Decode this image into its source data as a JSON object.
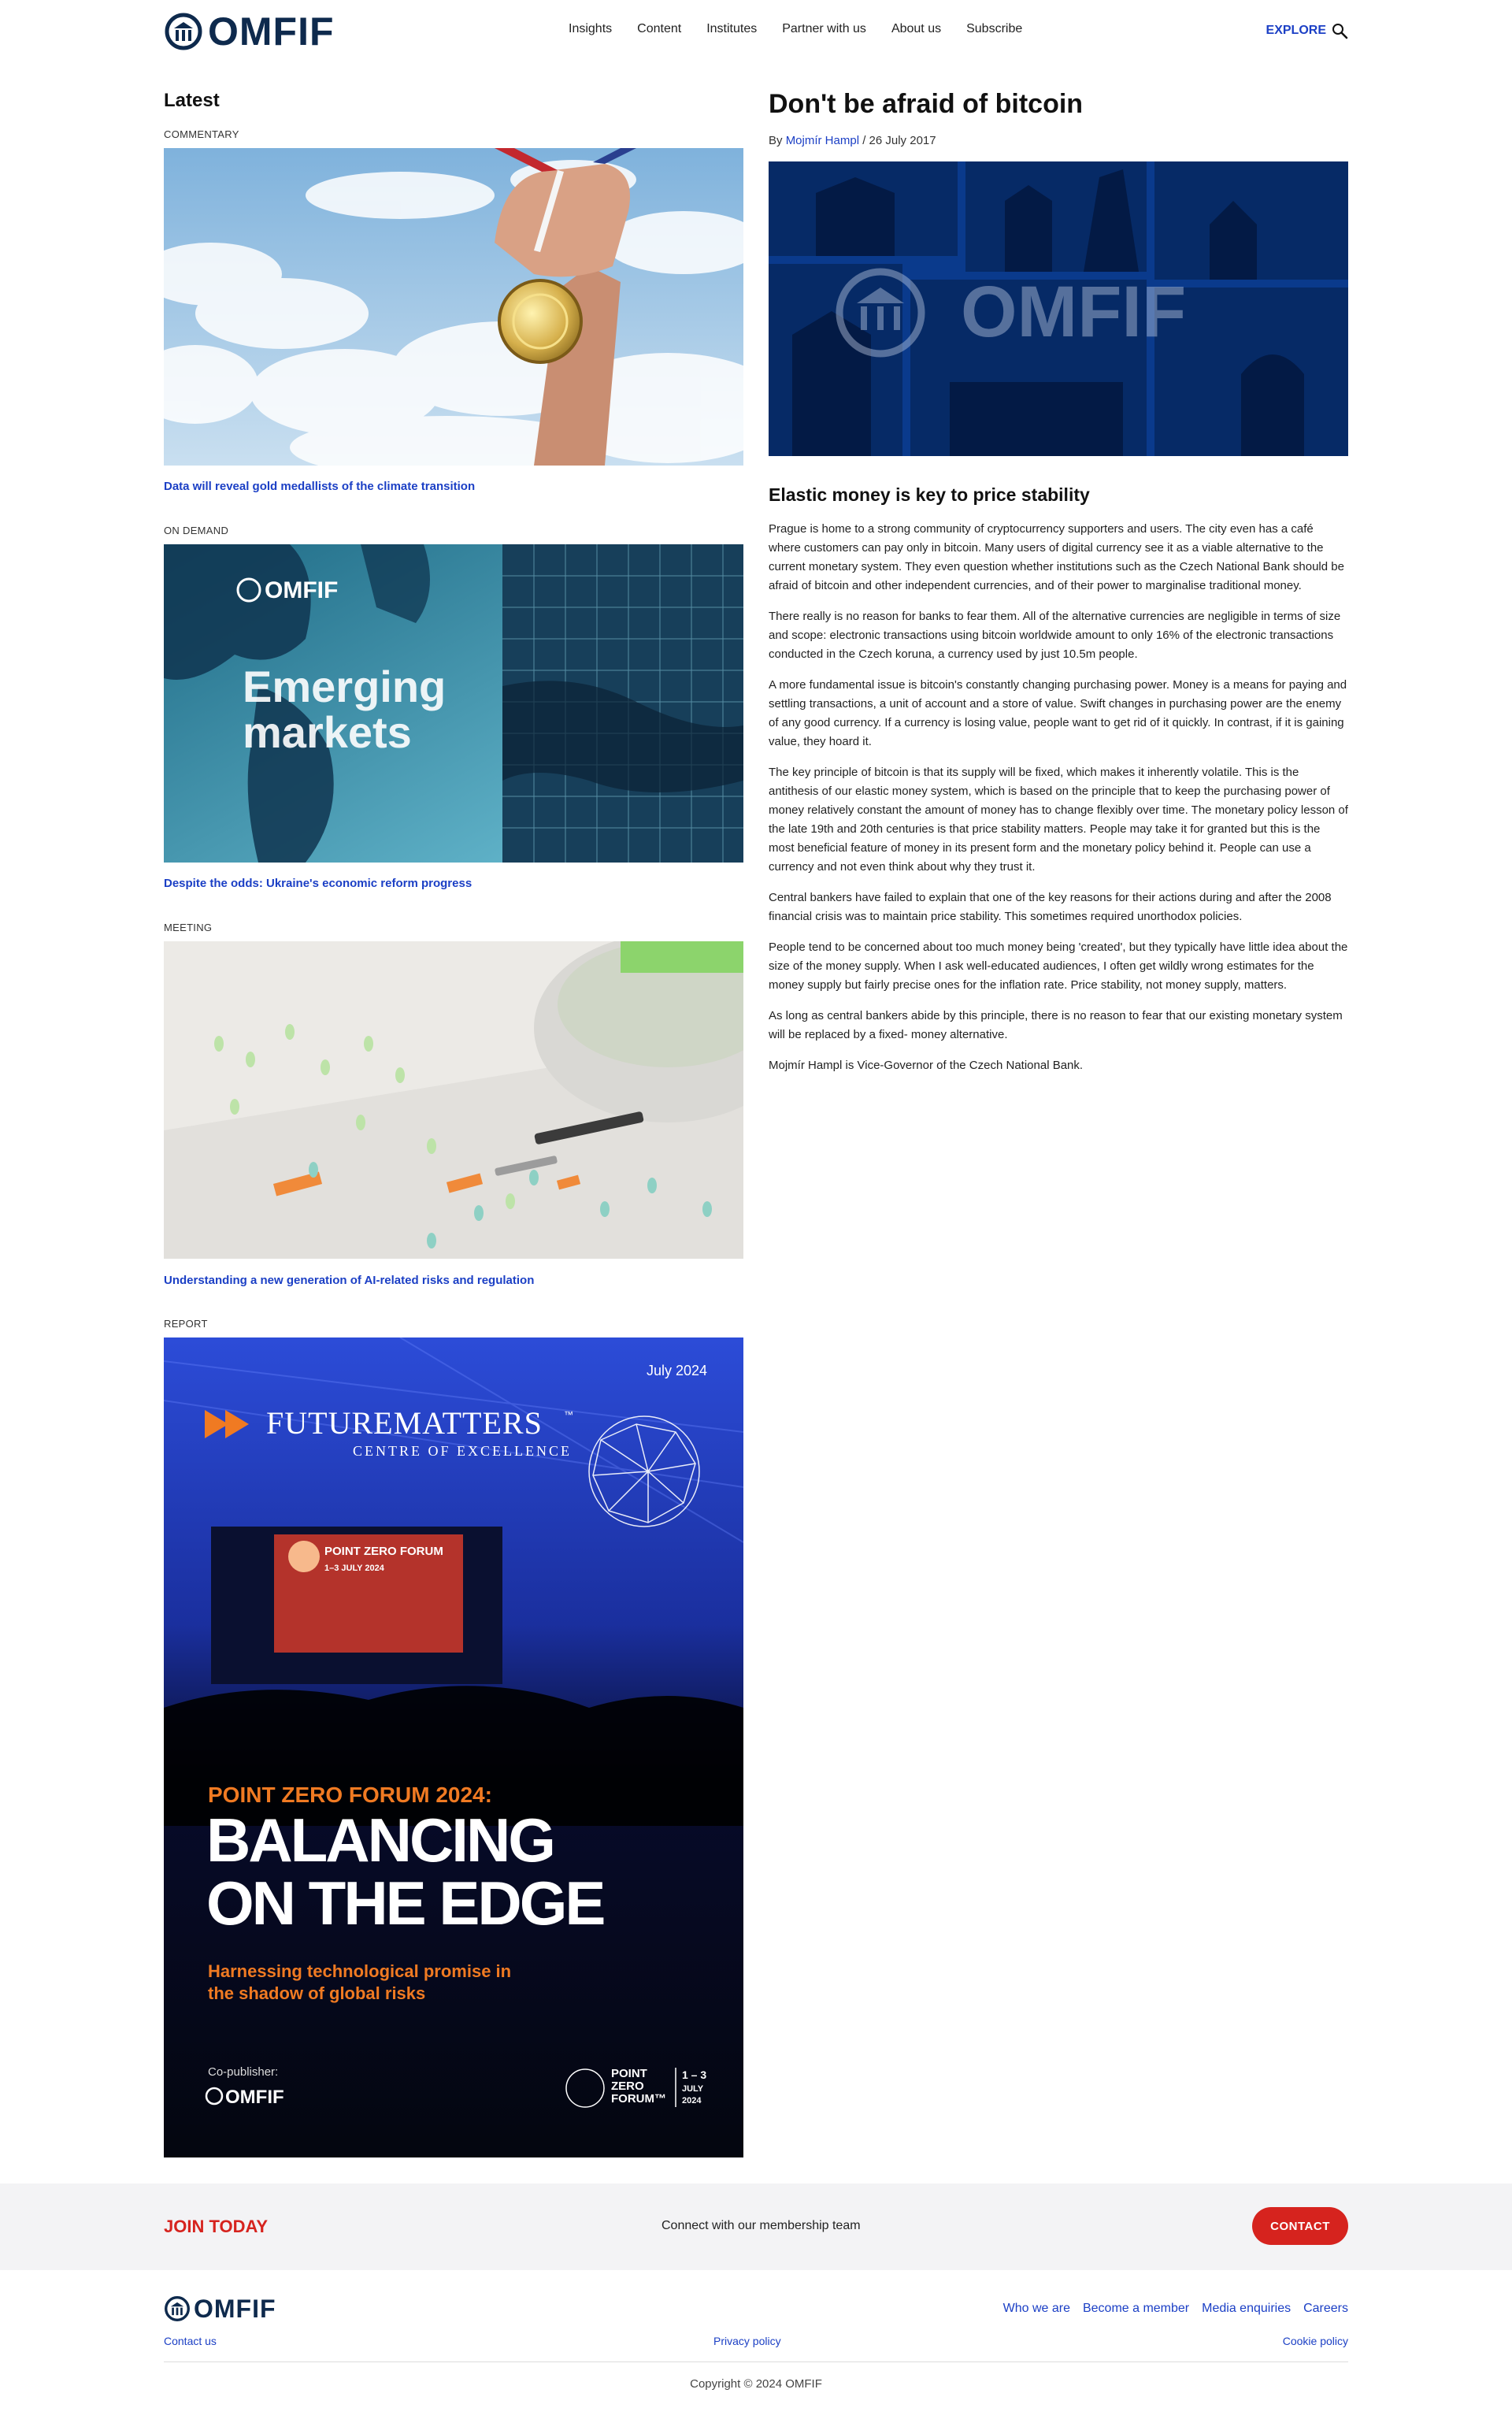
{
  "header": {
    "logo_text": "OMFIF",
    "nav": [
      "Insights",
      "Content",
      "Institutes",
      "Partner with us",
      "About us",
      "Subscribe"
    ],
    "explore_label": "EXPLORE"
  },
  "latest": {
    "title": "Latest",
    "cards": [
      {
        "category": "COMMENTARY",
        "title": "Data will reveal gold medallists of the climate transition"
      },
      {
        "category": "ON DEMAND",
        "title": "Despite the odds: Ukraine's economic reform progress",
        "image_text": {
          "logo": "OMFIF",
          "line1": "Emerging",
          "line2": "markets"
        }
      },
      {
        "category": "MEETING",
        "title": "Understanding a new generation of AI-related risks and regulation"
      },
      {
        "category": "REPORT",
        "image_text": {
          "date": "July 2024",
          "brand": "FUTUREMATTERS",
          "tm": "™",
          "brand_sub": "CENTRE OF EXCELLENCE",
          "stage_logo": "POINT ZERO FORUM",
          "stage_dates": "1–3 JULY 2024",
          "kicker": "POINT ZERO FORUM 2024:",
          "headline1": "BALANCING",
          "headline2": "ON THE EDGE",
          "subtitle1": "Harnessing technological promise in",
          "subtitle2": "the shadow of global risks",
          "copublisher": "Co-publisher:",
          "copublisher_logo": "OMFIF",
          "pzf_logo1": "POINT",
          "pzf_logo2": "ZERO",
          "pzf_logo3": "FORUM™",
          "pzf_date1": "1 – 3",
          "pzf_date2": "JULY",
          "pzf_date3": "2024"
        }
      }
    ]
  },
  "article": {
    "title": "Don't be afraid of bitcoin",
    "by": "By",
    "author": "Mojmír Hampl",
    "date": " / 26 July 2017",
    "hero_logo": "OMFIF",
    "subhead": "Elastic money is key to price stability",
    "paragraphs": [
      "Prague is home to a strong community of cryptocurrency supporters and users. The city even has a café where customers can pay only in bitcoin. Many users of digital currency see it as a viable alternative to the current monetary system. They even question whether institutions such as the Czech National Bank should be afraid of bitcoin and other independent currencies, and of their power to marginalise traditional money.",
      "There really is no reason for banks to fear them. All of the alternative currencies are negligible in terms of size and scope: electronic transactions using bitcoin worldwide amount to only 16% of the electronic transactions conducted in the Czech koruna, a currency used by just 10.5m people.",
      "A more fundamental issue is bitcoin's constantly changing purchasing power. Money is a means for paying and settling transactions, a unit of account and a store of value. Swift changes in purchasing power are the enemy of any good currency. If a currency is losing value, people want to get rid of it quickly. In contrast, if it is gaining value, they hoard it.",
      "The key principle of bitcoin is that its supply will be fixed, which makes it inherently volatile. This is the antithesis of our elastic money system, which is based on the principle that to keep the purchasing power of money relatively constant the amount of money has to change flexibly over time. The monetary policy lesson of the late 19th and 20th centuries is that price stability matters. People may take it for granted but this is the most beneficial feature of money in its present form and the monetary policy behind it. People can use a currency and not even think about why they trust it.",
      "Central bankers have failed to explain that one of the key reasons for their actions during and after the 2008 financial crisis was to maintain price stability. This sometimes required unorthodox policies.",
      "People tend to be concerned about too much money being 'created', but they typically have little idea about the size of the money supply. When I ask well-educated audiences, I often get wildly wrong estimates for the money supply but fairly precise ones for the inflation rate. Price stability, not money supply, matters.",
      "As long as central bankers abide by this principle, there is no reason to fear that our existing monetary system will be replaced by a fixed- money alternative.",
      "Mojmír Hampl is Vice-Governor of the Czech National Bank."
    ]
  },
  "join": {
    "title": "JOIN TODAY",
    "text": "Connect with our membership team",
    "button": "CONTACT"
  },
  "footer": {
    "logo_text": "OMFIF",
    "links": [
      "Who we are",
      "Become a member",
      "Media enquiries",
      "Careers"
    ],
    "contact": "Contact us",
    "privacy": "Privacy policy",
    "cookie": "Cookie policy",
    "copyright": "Copyright © 2024 OMFIF"
  },
  "colors": {
    "brand_navy": "#0e2a4d",
    "link_blue": "#1b3fc5",
    "accent_red": "#d6231e",
    "report_orange": "#f07a22"
  }
}
